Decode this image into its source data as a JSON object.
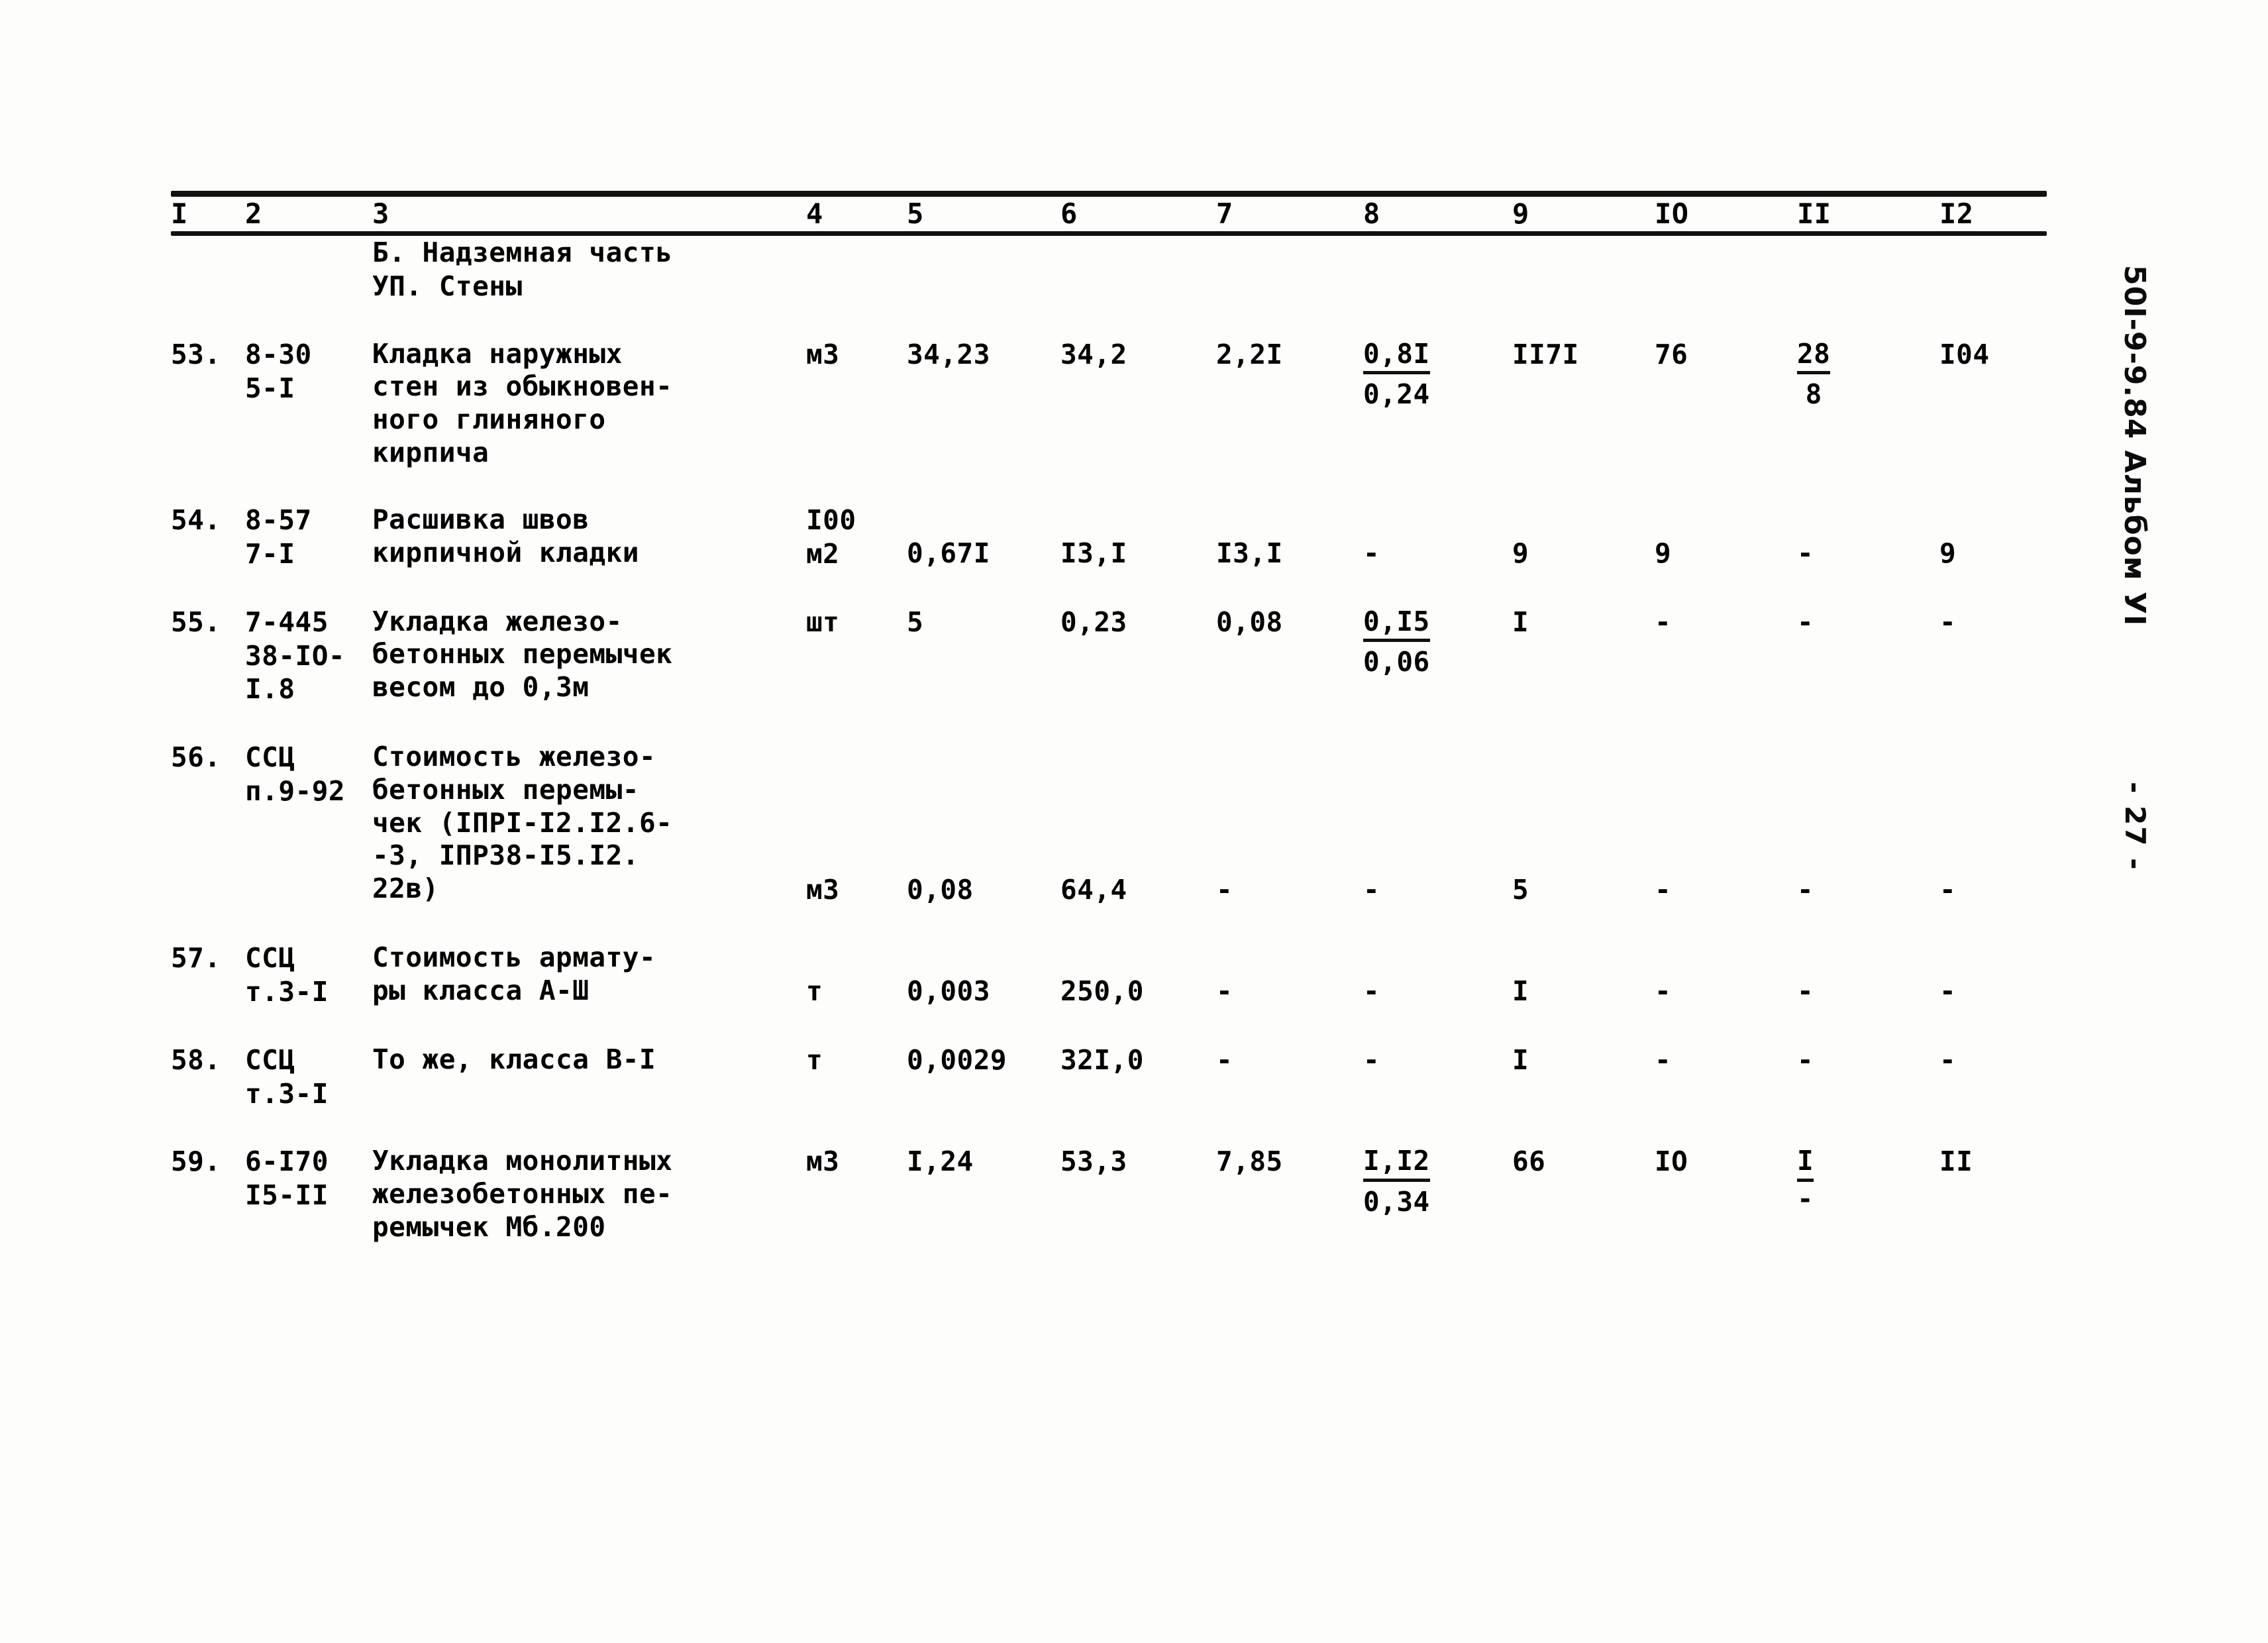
{
  "document": {
    "margin_code": "50I-9-9.84  Альбом УI",
    "page_number": "- 27 -"
  },
  "table": {
    "column_headers": [
      "I",
      "2",
      "3",
      "4",
      "5",
      "6",
      "7",
      "8",
      "9",
      "IO",
      "II",
      "I2"
    ],
    "sections": [
      {
        "title": "Б. Надземная часть"
      },
      {
        "title": "УП. Стены"
      }
    ],
    "rows": [
      {
        "no": "53.",
        "code_lines": [
          "8-30",
          "5-I"
        ],
        "description_lines": [
          "Кладка наружных",
          "стен из обыкновен-",
          "ного глиняного",
          "кирпича"
        ],
        "unit": "м3",
        "c5": "34,23",
        "c6": "34,2",
        "c7": "2,2I",
        "c8_top": "0,8I",
        "c8_bottom": "0,24",
        "c9": "II7I",
        "c10": "76",
        "c11_top": "28",
        "c11_bottom": "8",
        "c12": "I04"
      },
      {
        "no": "54.",
        "code_lines": [
          "8-57",
          "7-I"
        ],
        "description_lines": [
          "Расшивка швов",
          "кирпичной кладки"
        ],
        "unit_lines": [
          "I00",
          "м2"
        ],
        "c5": "0,67I",
        "c6": "I3,I",
        "c7": "I3,I",
        "c8": "-",
        "c9": "9",
        "c10": "9",
        "c11": "-",
        "c12": "9"
      },
      {
        "no": "55.",
        "code_lines": [
          "7-445",
          "38-IO-",
          "I.8"
        ],
        "description_lines": [
          "Укладка железо-",
          "бетонных перемычек",
          "весом до 0,3м"
        ],
        "unit": "шт",
        "c5": "5",
        "c6": "0,23",
        "c7": "0,08",
        "c8_top": "0,I5",
        "c8_bottom": "0,06",
        "c9": "I",
        "c10": "-",
        "c11": "-",
        "c12": "-"
      },
      {
        "no": "56.",
        "code_lines": [
          "ССЦ",
          "п.9-92"
        ],
        "description_lines": [
          "Стоимость железо-",
          "бетонных перемы-",
          "чек (IПРI-I2.I2.6-",
          "-3, IПР38-I5.I2.",
          "22в)"
        ],
        "unit": "м3",
        "c5": "0,08",
        "c6": "64,4",
        "c7": "-",
        "c8": "-",
        "c9": "5",
        "c10": "-",
        "c11": "-",
        "c12": "-"
      },
      {
        "no": "57.",
        "code_lines": [
          "ССЦ",
          "т.3-I"
        ],
        "description_lines": [
          "Стоимость армату-",
          "ры класса А-Ш"
        ],
        "unit": "т",
        "c5": "0,003",
        "c6": "250,0",
        "c7": "-",
        "c8": "-",
        "c9": "I",
        "c10": "-",
        "c11": "-",
        "c12": "-"
      },
      {
        "no": "58.",
        "code_lines": [
          "ССЦ",
          "т.3-I"
        ],
        "description_lines": [
          "То же, класса В-I"
        ],
        "unit": "т",
        "c5": "0,0029",
        "c6": "32I,0",
        "c7": "-",
        "c8": "-",
        "c9": "I",
        "c10": "-",
        "c11": "-",
        "c12": "-"
      },
      {
        "no": "59.",
        "code_lines": [
          "6-I70",
          "I5-II"
        ],
        "description_lines": [
          "Укладка монолитных",
          "железобетонных пе-",
          "ремычек Мб.200"
        ],
        "unit": "м3",
        "c5": "I,24",
        "c6": "53,3",
        "c7": "7,85",
        "c8_top": "I,I2",
        "c8_bottom": "0,34",
        "c9": "66",
        "c10": "IO",
        "c11_top": "I",
        "c11_bottom": "-",
        "c12": "II"
      }
    ]
  }
}
